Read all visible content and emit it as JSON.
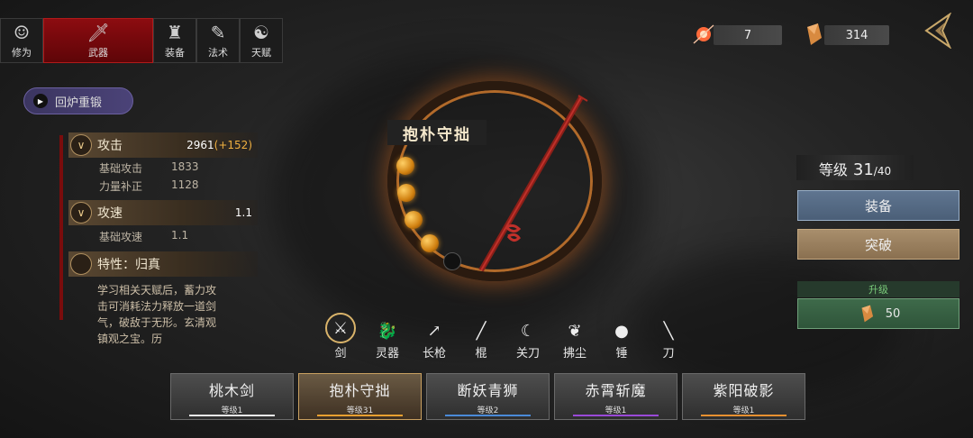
{
  "tabs": [
    {
      "label": "修为",
      "icon": "person-icon"
    },
    {
      "label": "武器",
      "icon": "sword-icon",
      "active": true
    },
    {
      "label": "装备",
      "icon": "robe-icon"
    },
    {
      "label": "法术",
      "icon": "scroll-icon"
    },
    {
      "label": "天赋",
      "icon": "taiji-icon"
    }
  ],
  "currency": {
    "essence": "7",
    "shard": "314"
  },
  "recast_label": "回炉重锻",
  "stats": {
    "attack": {
      "label": "攻击",
      "value": "2961",
      "bonus": "(+152)"
    },
    "base_attack": {
      "label": "基础攻击",
      "value": "1833"
    },
    "strength_bonus": {
      "label": "力量补正",
      "value": "1128"
    },
    "speed": {
      "label": "攻速",
      "value": "1.1"
    },
    "base_speed": {
      "label": "基础攻速",
      "value": "1.1"
    }
  },
  "trait": {
    "title": "特性：归真",
    "description": "学习相关天赋后，蓄力攻击可消耗法力释放一道剑气，破敌于无形。玄清观镇观之宝。历"
  },
  "weapon": {
    "name": "抱朴守拙"
  },
  "level": {
    "label": "等级",
    "current": "31",
    "max": "/40"
  },
  "buttons": {
    "equip": "装备",
    "breakthrough": "突破",
    "upgrade_label": "升级",
    "upgrade_cost": "50"
  },
  "weapon_types": [
    {
      "label": "剑",
      "active": true,
      "glyph": "⚔"
    },
    {
      "label": "灵器",
      "glyph": "🐉"
    },
    {
      "label": "长枪",
      "glyph": "↗"
    },
    {
      "label": "棍",
      "glyph": "╱"
    },
    {
      "label": "关刀",
      "glyph": "☾"
    },
    {
      "label": "拂尘",
      "glyph": "❦"
    },
    {
      "label": "锤",
      "glyph": "●"
    },
    {
      "label": "刀",
      "glyph": "╲"
    }
  ],
  "weapon_cards": [
    {
      "name": "桃木剑",
      "level": "等级1",
      "color": "#e8e8e8"
    },
    {
      "name": "抱朴守拙",
      "level": "等级31",
      "color": "#e8a030",
      "active": true
    },
    {
      "name": "断妖青狮",
      "level": "等级2",
      "color": "#4a8ad8"
    },
    {
      "name": "赤霄斩魔",
      "level": "等级1",
      "color": "#9a4ad8"
    },
    {
      "name": "紫阳破影",
      "level": "等级1",
      "color": "#e89030"
    }
  ]
}
